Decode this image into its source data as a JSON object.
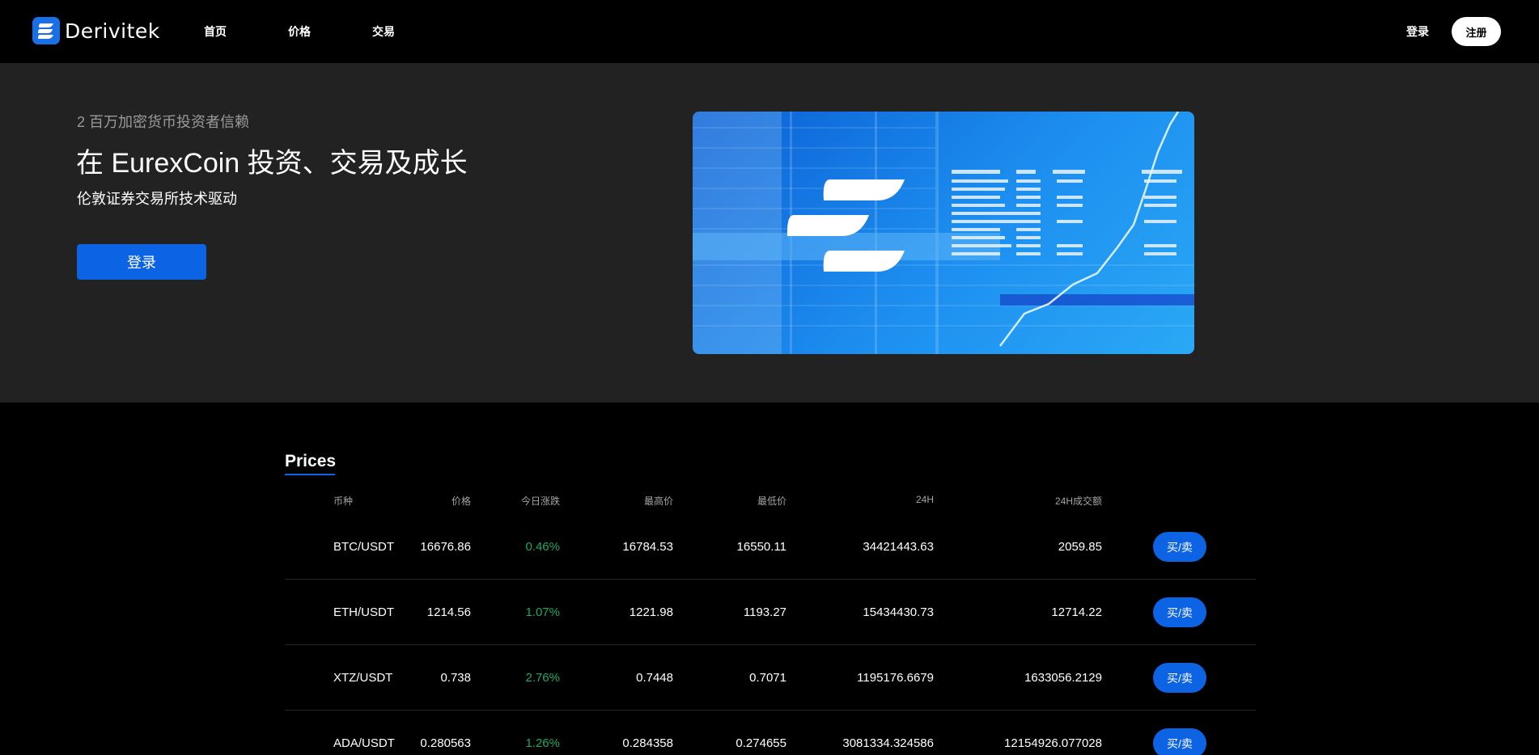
{
  "brand": {
    "name": "Derivitek"
  },
  "nav": {
    "items": [
      "首页",
      "价格",
      "交易"
    ],
    "login": "登录",
    "signup": "注册"
  },
  "hero": {
    "tagline": "2 百万加密货币投资者信赖",
    "title": "在 EurexCoin 投资、交易及成长",
    "subtitle": "伦敦证券交易所技术驱动",
    "login_button": "登录"
  },
  "prices": {
    "title": "Prices",
    "columns": [
      "币种",
      "价格",
      "今日涨跌",
      "最高价",
      "最低价",
      "24H",
      "24H成交额"
    ],
    "trade_label": "买/卖",
    "rows": [
      {
        "pair": "BTC/USDT",
        "price": "16676.86",
        "change": "0.46%",
        "high": "16784.53",
        "low": "16550.11",
        "h24": "34421443.63",
        "volume": "2059.85"
      },
      {
        "pair": "ETH/USDT",
        "price": "1214.56",
        "change": "1.07%",
        "high": "1221.98",
        "low": "1193.27",
        "h24": "15434430.73",
        "volume": "12714.22"
      },
      {
        "pair": "XTZ/USDT",
        "price": "0.738",
        "change": "2.76%",
        "high": "0.7448",
        "low": "0.7071",
        "h24": "1195176.6679",
        "volume": "1633056.2129"
      },
      {
        "pair": "ADA/USDT",
        "price": "0.280563",
        "change": "1.26%",
        "high": "0.284358",
        "low": "0.274655",
        "h24": "3081334.324586",
        "volume": "12154926.077028"
      }
    ]
  },
  "colors": {
    "accent": "#0c63e4",
    "positive": "#1fa863",
    "hero_bg": "#222222",
    "page_bg": "#000000"
  }
}
